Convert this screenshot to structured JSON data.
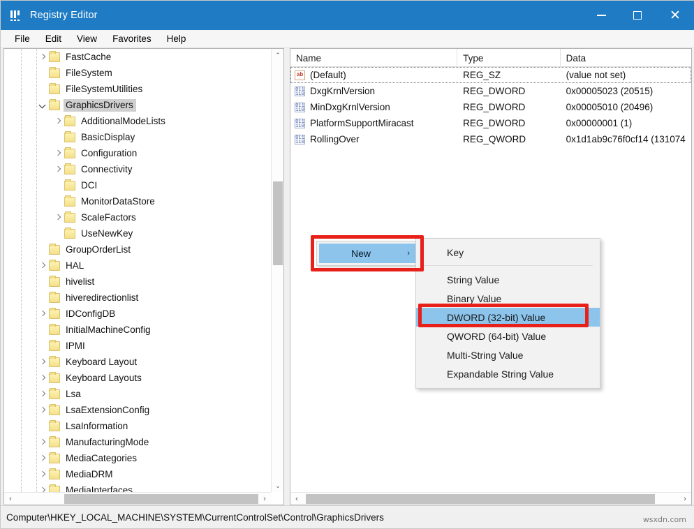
{
  "window": {
    "title": "Registry Editor",
    "icon": "registry-editor-icon",
    "minimize_label": "–",
    "maximize_label": "□",
    "close_label": "×"
  },
  "menubar": {
    "items": [
      "File",
      "Edit",
      "View",
      "Favorites",
      "Help"
    ]
  },
  "tree": {
    "items": [
      {
        "label": "FastCache",
        "depth": 1,
        "expander": "right"
      },
      {
        "label": "FileSystem",
        "depth": 1,
        "expander": "none"
      },
      {
        "label": "FileSystemUtilities",
        "depth": 1,
        "expander": "none"
      },
      {
        "label": "GraphicsDrivers",
        "depth": 1,
        "expander": "down",
        "selected": true
      },
      {
        "label": "AdditionalModeLists",
        "depth": 2,
        "expander": "right"
      },
      {
        "label": "BasicDisplay",
        "depth": 2,
        "expander": "none"
      },
      {
        "label": "Configuration",
        "depth": 2,
        "expander": "right"
      },
      {
        "label": "Connectivity",
        "depth": 2,
        "expander": "right"
      },
      {
        "label": "DCI",
        "depth": 2,
        "expander": "none"
      },
      {
        "label": "MonitorDataStore",
        "depth": 2,
        "expander": "none"
      },
      {
        "label": "ScaleFactors",
        "depth": 2,
        "expander": "right"
      },
      {
        "label": "UseNewKey",
        "depth": 2,
        "expander": "none"
      },
      {
        "label": "GroupOrderList",
        "depth": 1,
        "expander": "none"
      },
      {
        "label": "HAL",
        "depth": 1,
        "expander": "right"
      },
      {
        "label": "hivelist",
        "depth": 1,
        "expander": "none"
      },
      {
        "label": "hiveredirectionlist",
        "depth": 1,
        "expander": "none"
      },
      {
        "label": "IDConfigDB",
        "depth": 1,
        "expander": "right"
      },
      {
        "label": "InitialMachineConfig",
        "depth": 1,
        "expander": "none"
      },
      {
        "label": "IPMI",
        "depth": 1,
        "expander": "none"
      },
      {
        "label": "Keyboard Layout",
        "depth": 1,
        "expander": "right"
      },
      {
        "label": "Keyboard Layouts",
        "depth": 1,
        "expander": "right"
      },
      {
        "label": "Lsa",
        "depth": 1,
        "expander": "right"
      },
      {
        "label": "LsaExtensionConfig",
        "depth": 1,
        "expander": "right"
      },
      {
        "label": "LsaInformation",
        "depth": 1,
        "expander": "none"
      },
      {
        "label": "ManufacturingMode",
        "depth": 1,
        "expander": "right"
      },
      {
        "label": "MediaCategories",
        "depth": 1,
        "expander": "right"
      },
      {
        "label": "MediaDRM",
        "depth": 1,
        "expander": "right"
      },
      {
        "label": "MediaInterfaces",
        "depth": 1,
        "expander": "right"
      }
    ]
  },
  "values": {
    "columns": [
      "Name",
      "Type",
      "Data"
    ],
    "rows": [
      {
        "icon": "ab",
        "icon_text": "ab",
        "name": "(Default)",
        "type": "REG_SZ",
        "data": "(value not set)",
        "focused": true
      },
      {
        "icon": "binary",
        "icon_text": "011\n110",
        "name": "DxgKrnlVersion",
        "type": "REG_DWORD",
        "data": "0x00005023 (20515)"
      },
      {
        "icon": "binary",
        "icon_text": "011\n110",
        "name": "MinDxgKrnlVersion",
        "type": "REG_DWORD",
        "data": "0x00005010 (20496)"
      },
      {
        "icon": "binary",
        "icon_text": "011\n110",
        "name": "PlatformSupportMiracast",
        "type": "REG_DWORD",
        "data": "0x00000001 (1)"
      },
      {
        "icon": "binary",
        "icon_text": "011\n110",
        "name": "RollingOver",
        "type": "REG_QWORD",
        "data": "0x1d1ab9c76f0cf14 (131074"
      }
    ]
  },
  "context_menu": {
    "parent_label": "New",
    "submenu_arrow": "›",
    "submenu_items": [
      {
        "label": "Key",
        "highlighted": false,
        "separator_after": true
      },
      {
        "label": "String Value",
        "highlighted": false
      },
      {
        "label": "Binary Value",
        "highlighted": false
      },
      {
        "label": "DWORD (32-bit) Value",
        "highlighted": true
      },
      {
        "label": "QWORD (64-bit) Value",
        "highlighted": false
      },
      {
        "label": "Multi-String Value",
        "highlighted": false
      },
      {
        "label": "Expandable String Value",
        "highlighted": false
      }
    ]
  },
  "statusbar": {
    "path": "Computer\\HKEY_LOCAL_MACHINE\\SYSTEM\\CurrentControlSet\\Control\\GraphicsDrivers"
  },
  "watermark": {
    "text": "wsxdn.com"
  },
  "scrollbars": {
    "up_arrow": "⌃",
    "down_arrow": "⌄",
    "left_arrow": "‹",
    "right_arrow": "›"
  },
  "colors": {
    "titlebar": "#1e7bc4",
    "menu_highlight": "#8cc4ec",
    "annotation_red": "#e8201a",
    "tree_selection": "#cfcfcf",
    "folder": "#f4e08a"
  }
}
